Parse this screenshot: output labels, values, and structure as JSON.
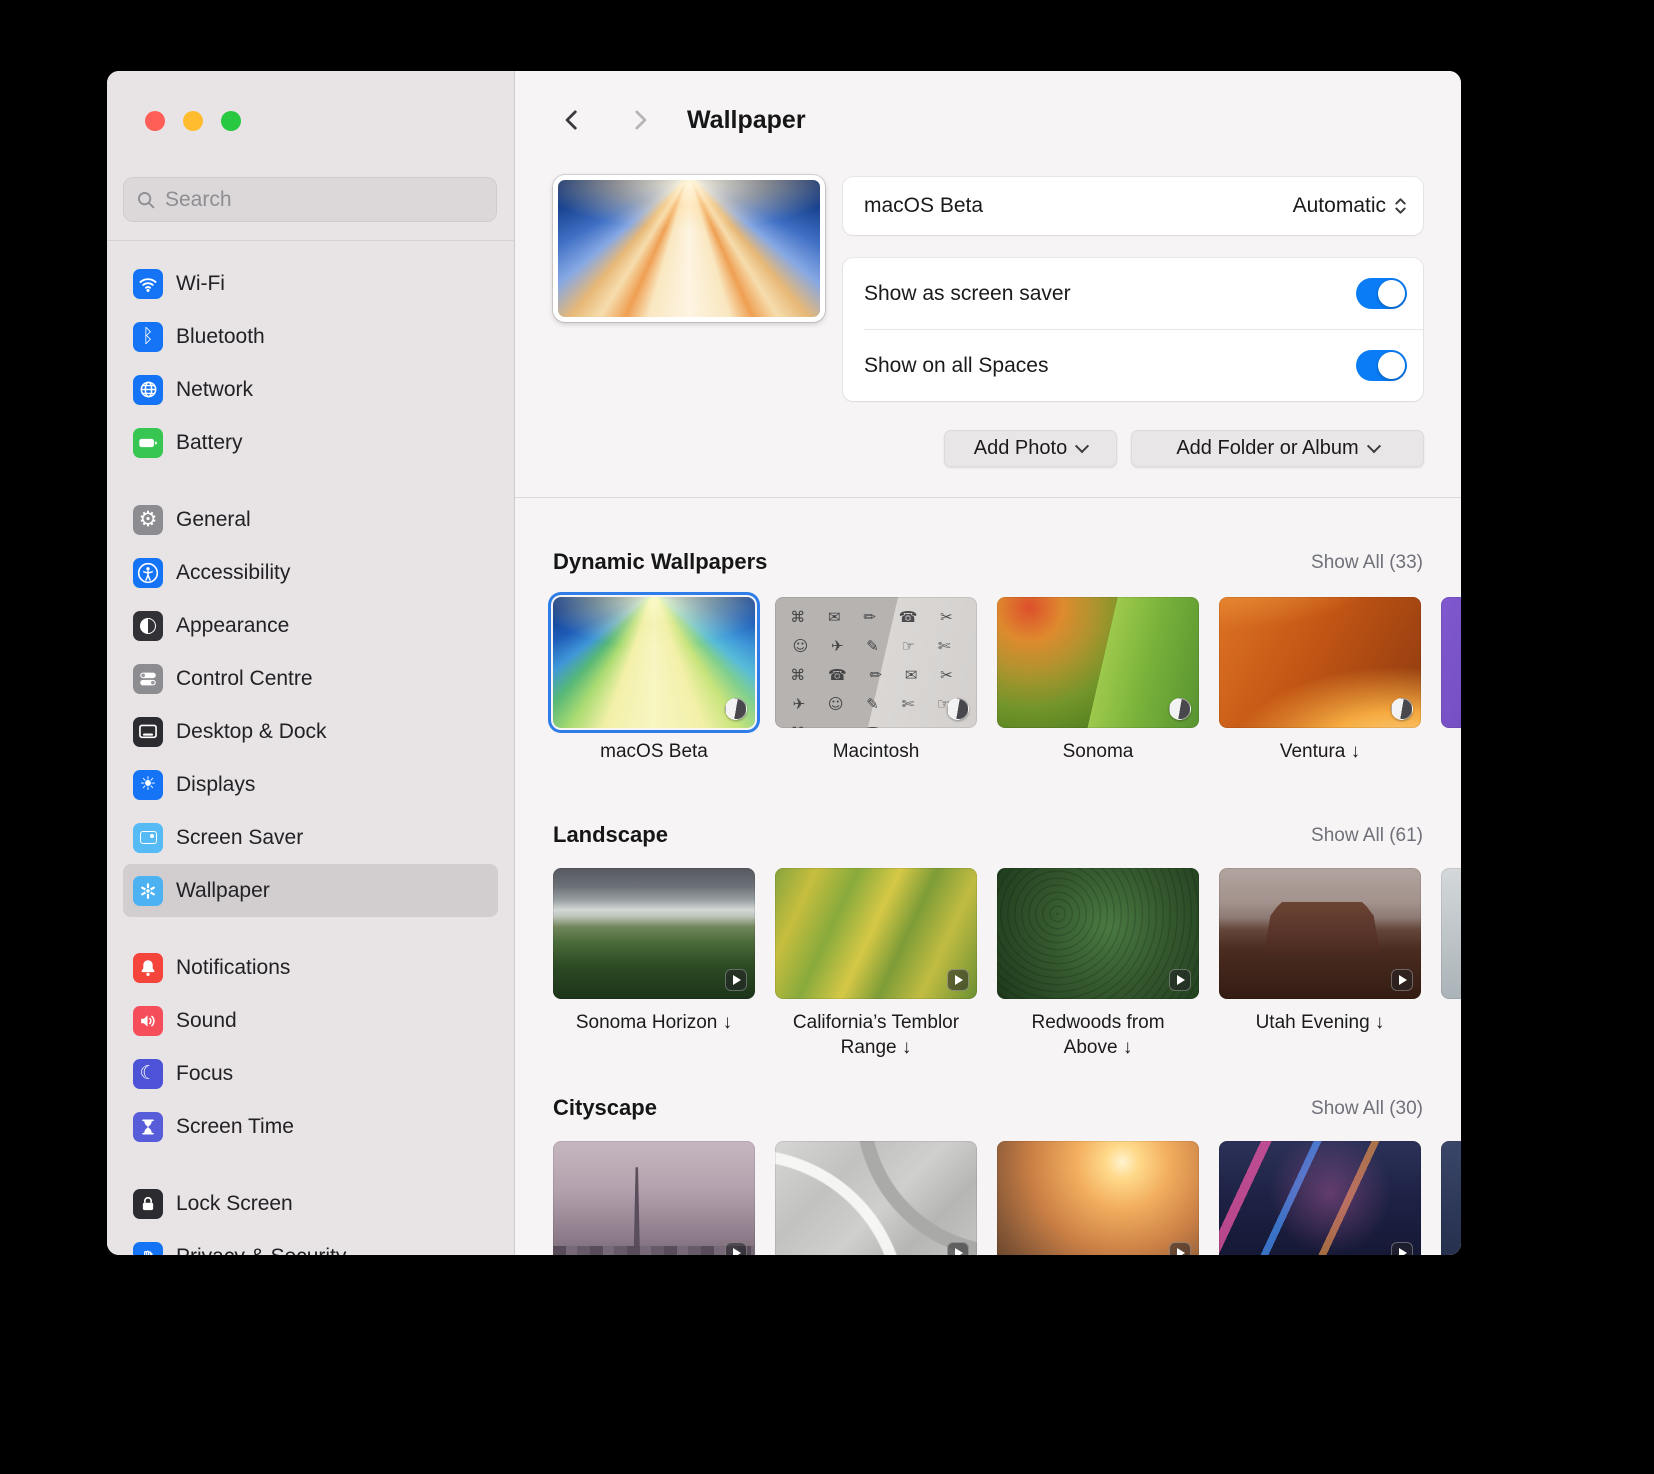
{
  "colors": {
    "accent_blue": "#0a7cf6",
    "selection_ring": "#2e7de9",
    "traffic_red": "#ff5f57",
    "traffic_yellow": "#febc2e",
    "traffic_green": "#28c840"
  },
  "sidebar": {
    "search_placeholder": "Search",
    "groups": [
      {
        "items": [
          {
            "label": "Wi-Fi",
            "icon": "wifi-icon",
            "bg": "#1574f6"
          },
          {
            "label": "Bluetooth",
            "icon": "bluetooth-icon",
            "bg": "#1574f6",
            "glyph": "ᛒ"
          },
          {
            "label": "Network",
            "icon": "network-globe-icon",
            "bg": "#1574f6"
          },
          {
            "label": "Battery",
            "icon": "battery-icon",
            "bg": "#38c653"
          }
        ]
      },
      {
        "items": [
          {
            "label": "General",
            "icon": "gear-icon",
            "bg": "#8c8c91",
            "glyph": "⚙"
          },
          {
            "label": "Accessibility",
            "icon": "accessibility-icon",
            "bg": "#1574f6"
          },
          {
            "label": "Appearance",
            "icon": "appearance-icon",
            "bg": "#313136"
          },
          {
            "label": "Control Centre",
            "icon": "control-centre-icon",
            "bg": "#8c8c91"
          },
          {
            "label": "Desktop & Dock",
            "icon": "desktop-dock-icon",
            "bg": "#2b2b30"
          },
          {
            "label": "Displays",
            "icon": "display-brightness-icon",
            "bg": "#1574f6",
            "glyph": "☀"
          },
          {
            "label": "Screen Saver",
            "icon": "screen-saver-icon",
            "bg": "#56baf4"
          },
          {
            "label": "Wallpaper",
            "icon": "wallpaper-flower-icon",
            "bg": "#4db2f2",
            "selected": true
          }
        ]
      },
      {
        "items": [
          {
            "label": "Notifications",
            "icon": "notifications-bell-icon",
            "bg": "#f5443c"
          },
          {
            "label": "Sound",
            "icon": "sound-speaker-icon",
            "bg": "#f54e5a"
          },
          {
            "label": "Focus",
            "icon": "focus-moon-icon",
            "bg": "#4d53d6",
            "glyph": "☾"
          },
          {
            "label": "Screen Time",
            "icon": "screen-time-hourglass-icon",
            "bg": "#575dd8"
          }
        ]
      },
      {
        "items": [
          {
            "label": "Lock Screen",
            "icon": "lock-icon",
            "bg": "#2b2b30"
          },
          {
            "label": "Privacy & Security",
            "icon": "privacy-hand-icon",
            "bg": "#1574f6"
          }
        ]
      }
    ]
  },
  "header": {
    "title": "Wallpaper"
  },
  "current": {
    "name": "macOS Beta",
    "mode": "Automatic",
    "screen_saver_label": "Show as screen saver",
    "spaces_label": "Show on all Spaces"
  },
  "buttons": {
    "add_photo": "Add Photo",
    "add_folder": "Add Folder or Album"
  },
  "sections": {
    "dynamic": {
      "title": "Dynamic Wallpapers",
      "show_all": "Show All (33)",
      "items": [
        {
          "label": "macOS Beta"
        },
        {
          "label": "Macintosh"
        },
        {
          "label": "Sonoma"
        },
        {
          "label": "Ventura ↓"
        }
      ]
    },
    "landscape": {
      "title": "Landscape",
      "show_all": "Show All (61)",
      "items": [
        {
          "label": "Sonoma Horizon ↓"
        },
        {
          "label": "California’s Temblor Range ↓"
        },
        {
          "label": "Redwoods from Above ↓"
        },
        {
          "label": "Utah Evening ↓"
        }
      ]
    },
    "cityscape": {
      "title": "Cityscape",
      "show_all": "Show All (30)"
    }
  },
  "macintosh_pattern": "⌘ ✉ ✏ ☎ ✂ ☺ ✈ ✎ ☞ ✄ ⌘ ☎ ✏ ✉ ✂ ✈ ☺ ✎ ✄ ☞ ⌘ ✉ ☎ ✏ ✂ ☺ ✈ ✎"
}
